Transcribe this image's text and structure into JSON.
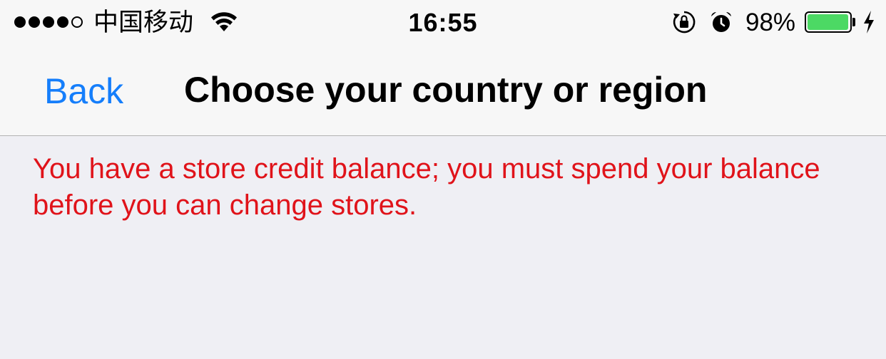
{
  "status_bar": {
    "carrier": "中国移动",
    "signal_bars_filled": 4,
    "signal_bars_total": 5,
    "time": "16:55",
    "battery_percent_label": "98%",
    "battery_level": 0.98,
    "icons": [
      "wifi-icon",
      "rotation-lock-icon",
      "alarm-icon",
      "battery-icon",
      "charging-bolt-icon"
    ],
    "battery_color": "#4cd964"
  },
  "nav": {
    "back_label": "Back",
    "title": "Choose your country or region",
    "accent_color": "#157efb"
  },
  "message": {
    "text": "You have a store credit balance; you must spend your balance before you can change stores.",
    "color": "#e0131a"
  }
}
